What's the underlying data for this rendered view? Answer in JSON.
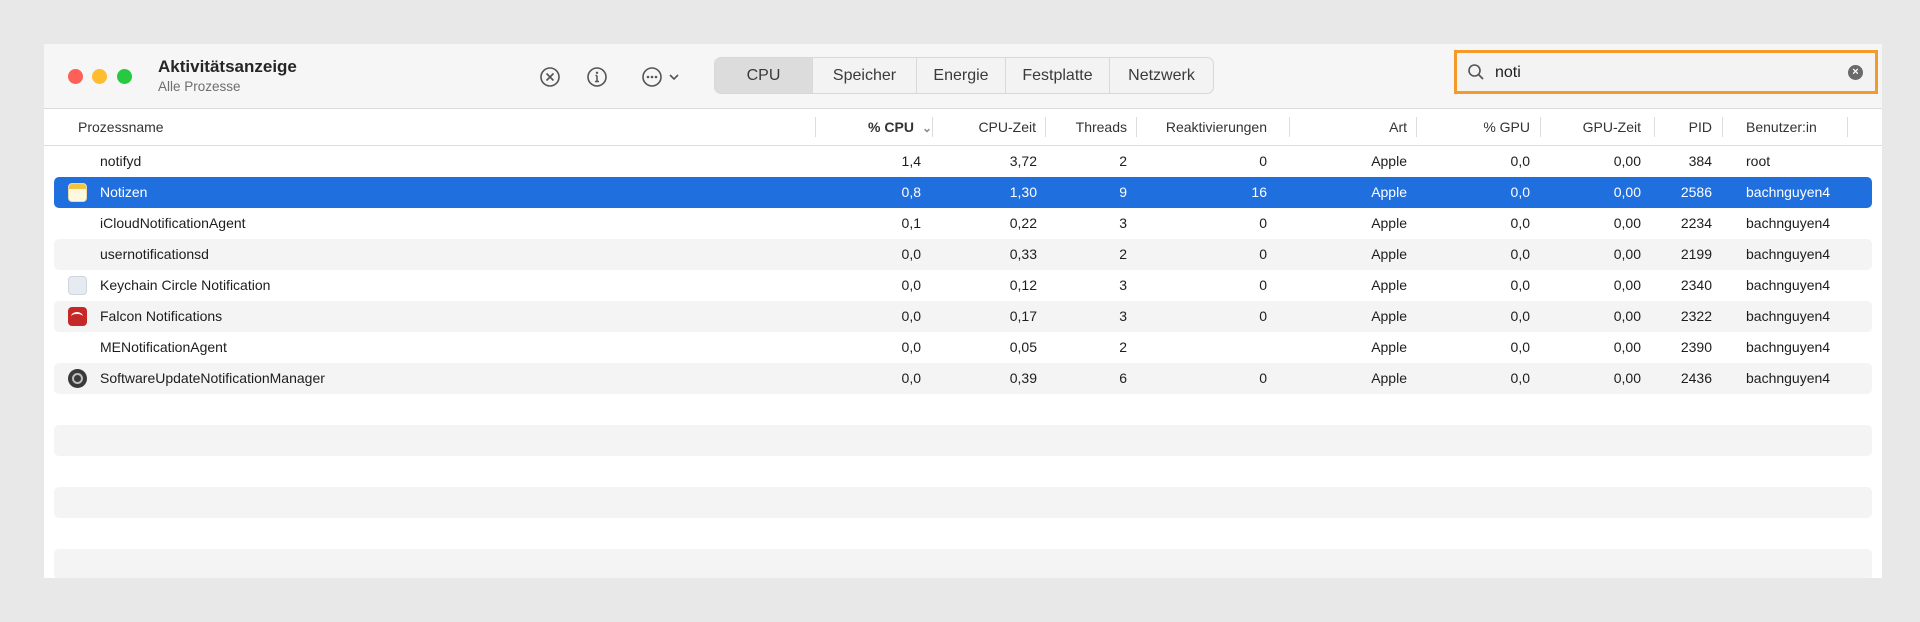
{
  "window": {
    "title": "Aktivitätsanzeige",
    "subtitle": "Alle Prozesse"
  },
  "toolbar": {
    "icons": [
      "stop-process-icon",
      "info-icon",
      "more-actions-icon"
    ],
    "tabs": [
      {
        "label": "CPU",
        "active": true
      },
      {
        "label": "Speicher",
        "active": false
      },
      {
        "label": "Energie",
        "active": false
      },
      {
        "label": "Festplatte",
        "active": false
      },
      {
        "label": "Netzwerk",
        "active": false
      }
    ]
  },
  "search": {
    "value": "noti",
    "highlight_color": "#f39a2b"
  },
  "table": {
    "columns": {
      "name": "Prozessname",
      "cpu": "% CPU",
      "cpu_time": "CPU-Zeit",
      "threads": "Threads",
      "wakeups": "Reaktivierungen",
      "kind": "Art",
      "gpu": "% GPU",
      "gpu_time": "GPU-Zeit",
      "pid": "PID",
      "user": "Benutzer:in"
    },
    "sort": {
      "column": "cpu",
      "direction": "descending"
    },
    "selection_color": "#1f6fde",
    "rows": [
      {
        "icon": "none",
        "name": "notifyd",
        "cpu": "1,4",
        "cpu_time": "3,72",
        "threads": "2",
        "wakeups": "0",
        "kind": "Apple",
        "gpu": "0,0",
        "gpu_time": "0,00",
        "pid": "384",
        "user": "root",
        "selected": false
      },
      {
        "icon": "notes-app-icon",
        "name": "Notizen",
        "cpu": "0,8",
        "cpu_time": "1,30",
        "threads": "9",
        "wakeups": "16",
        "kind": "Apple",
        "gpu": "0,0",
        "gpu_time": "0,00",
        "pid": "2586",
        "user": "bachnguyen4",
        "selected": true
      },
      {
        "icon": "none",
        "name": "iCloudNotificationAgent",
        "cpu": "0,1",
        "cpu_time": "0,22",
        "threads": "3",
        "wakeups": "0",
        "kind": "Apple",
        "gpu": "0,0",
        "gpu_time": "0,00",
        "pid": "2234",
        "user": "bachnguyen4",
        "selected": false
      },
      {
        "icon": "none",
        "name": "usernotificationsd",
        "cpu": "0,0",
        "cpu_time": "0,33",
        "threads": "2",
        "wakeups": "0",
        "kind": "Apple",
        "gpu": "0,0",
        "gpu_time": "0,00",
        "pid": "2199",
        "user": "bachnguyen4",
        "selected": false
      },
      {
        "icon": "keychain-icon",
        "name": "Keychain Circle Notification",
        "cpu": "0,0",
        "cpu_time": "0,12",
        "threads": "3",
        "wakeups": "0",
        "kind": "Apple",
        "gpu": "0,0",
        "gpu_time": "0,00",
        "pid": "2340",
        "user": "bachnguyen4",
        "selected": false
      },
      {
        "icon": "falcon-icon",
        "name": "Falcon Notifications",
        "cpu": "0,0",
        "cpu_time": "0,17",
        "threads": "3",
        "wakeups": "0",
        "kind": "Apple",
        "gpu": "0,0",
        "gpu_time": "0,00",
        "pid": "2322",
        "user": "bachnguyen4",
        "selected": false
      },
      {
        "icon": "none",
        "name": "MENotificationAgent",
        "cpu": "0,0",
        "cpu_time": "0,05",
        "threads": "2",
        "wakeups": "",
        "kind": "Apple",
        "gpu": "0,0",
        "gpu_time": "0,00",
        "pid": "2390",
        "user": "bachnguyen4",
        "selected": false
      },
      {
        "icon": "software-update-gear-icon",
        "name": "SoftwareUpdateNotificationManager",
        "cpu": "0,0",
        "cpu_time": "0,39",
        "threads": "6",
        "wakeups": "0",
        "kind": "Apple",
        "gpu": "0,0",
        "gpu_time": "0,00",
        "pid": "2436",
        "user": "bachnguyen4",
        "selected": false
      }
    ]
  }
}
